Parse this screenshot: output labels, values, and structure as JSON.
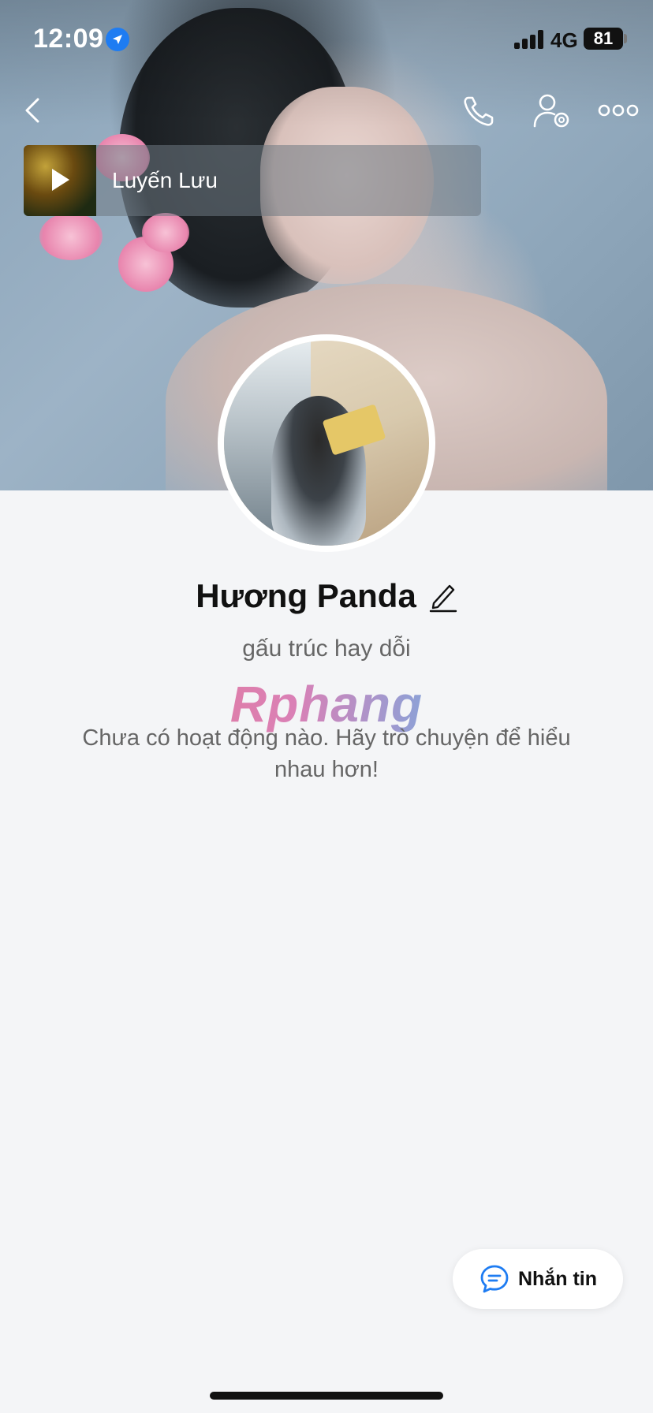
{
  "status_bar": {
    "time": "12:09",
    "network": "4G",
    "battery": "81"
  },
  "nav": {
    "back_icon": "chevron-left-icon",
    "call_icon": "phone-icon",
    "settings_icon": "user-settings-icon",
    "more_icon": "more-horizontal-icon"
  },
  "music": {
    "title": "Luyến Lưu"
  },
  "profile": {
    "name": "Hương Panda",
    "bio": "gấu trúc hay dỗi",
    "watermark": "Rphang",
    "empty_message": "Chưa có hoạt động nào. Hãy trò chuyện để hiểu nhau hơn!"
  },
  "actions": {
    "message_label": "Nhắn tin"
  },
  "colors": {
    "accent": "#1e7cf2",
    "background": "#f4f5f7",
    "text_primary": "#111111",
    "text_secondary": "#666666"
  }
}
